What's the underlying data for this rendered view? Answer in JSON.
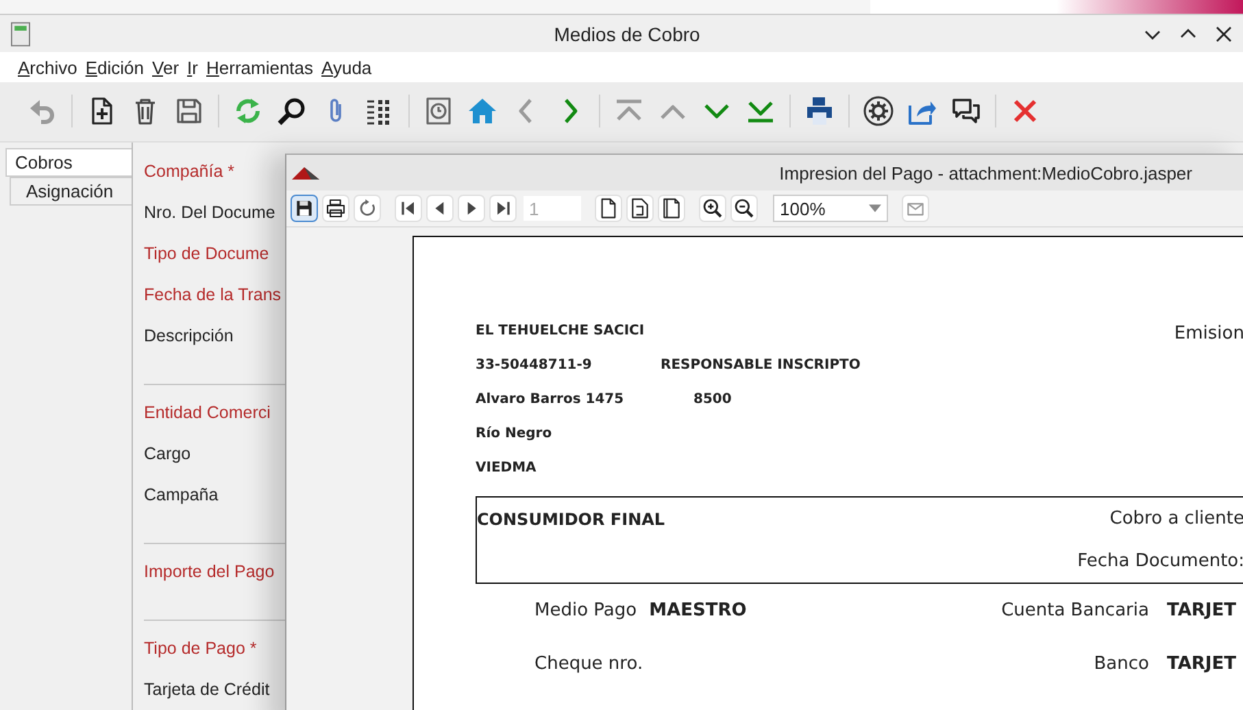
{
  "window": {
    "title": "Medios de Cobro"
  },
  "menu": [
    {
      "label": "Archivo"
    },
    {
      "label": "Edición"
    },
    {
      "label": "Ver"
    },
    {
      "label": "Ir"
    },
    {
      "label": "Herramientas"
    },
    {
      "label": "Ayuda"
    }
  ],
  "toolbar": [
    [
      {
        "kind": "undo",
        "disabled": true
      }
    ],
    [
      {
        "kind": "new",
        "disabled": false
      },
      {
        "kind": "delete",
        "disabled": false
      },
      {
        "kind": "save",
        "disabled": false
      }
    ],
    [
      {
        "kind": "refresh",
        "disabled": false
      },
      {
        "kind": "find",
        "disabled": false
      },
      {
        "kind": "attach",
        "disabled": false
      },
      {
        "kind": "grid",
        "disabled": false
      }
    ],
    [
      {
        "kind": "history",
        "disabled": false
      },
      {
        "kind": "home",
        "disabled": false
      },
      {
        "kind": "back",
        "disabled": true
      },
      {
        "kind": "forward",
        "disabled": false
      }
    ],
    [
      {
        "kind": "first",
        "disabled": true
      },
      {
        "kind": "prev",
        "disabled": true
      },
      {
        "kind": "next",
        "disabled": false
      },
      {
        "kind": "last",
        "disabled": false
      }
    ],
    [
      {
        "kind": "print",
        "disabled": false
      }
    ],
    [
      {
        "kind": "process",
        "disabled": false
      },
      {
        "kind": "export",
        "disabled": false
      },
      {
        "kind": "chat",
        "disabled": false
      }
    ],
    [
      {
        "kind": "close",
        "disabled": false
      }
    ]
  ],
  "tabs": [
    {
      "label": "Cobros",
      "selected": true
    },
    {
      "label": "Asignación",
      "selected": false
    }
  ],
  "form_groups": [
    [
      {
        "label": "Compañía *",
        "mandatory": true
      },
      {
        "label": "Nro. Del Docume",
        "mandatory": false
      },
      {
        "label": "Tipo de Docume",
        "mandatory": true
      },
      {
        "label": "Fecha de la Trans",
        "mandatory": true
      },
      {
        "label": "Descripción",
        "mandatory": false
      }
    ],
    [
      {
        "label": "Entidad Comerci",
        "mandatory": true
      },
      {
        "label": "Cargo",
        "mandatory": false
      },
      {
        "label": "Campaña",
        "mandatory": false
      }
    ],
    [
      {
        "label": "Importe del Pago",
        "mandatory": true
      }
    ],
    [
      {
        "label": "Tipo de Pago *",
        "mandatory": true
      },
      {
        "label": "Tarjeta de Crédit",
        "mandatory": false
      }
    ]
  ],
  "report_window": {
    "title": "Impresion del Pago - attachment:MedioCobro.jasper",
    "toolbar": [
      [
        {
          "kind": "save",
          "disabled": false
        },
        {
          "kind": "print",
          "disabled": false
        },
        {
          "kind": "reload",
          "disabled": false
        }
      ],
      [
        {
          "kind": "first",
          "disabled": false
        },
        {
          "kind": "prev",
          "disabled": false
        },
        {
          "kind": "next",
          "disabled": false
        },
        {
          "kind": "last",
          "disabled": false
        }
      ],
      [
        {
          "kind": "page-actual",
          "disabled": false
        },
        {
          "kind": "page-width",
          "disabled": false
        },
        {
          "kind": "page-fit",
          "disabled": false
        }
      ],
      [
        {
          "kind": "zoom-in",
          "disabled": false
        },
        {
          "kind": "zoom-out",
          "disabled": false
        }
      ],
      [
        {
          "kind": "email",
          "disabled": true
        }
      ]
    ],
    "page_number": "1",
    "zoom": "100%",
    "document": {
      "issuer_name": "EL TEHUELCHE SACICI",
      "emission_label": "Emision",
      "tax_id": "33-50448711-9",
      "tax_status": "RESPONSABLE INSCRIPTO",
      "address": "Alvaro Barros 1475",
      "postal_code": "8500",
      "province": "Río Negro",
      "city": "VIEDMA",
      "customer": "CONSUMIDOR FINAL",
      "doc_type": "Cobro a cliente",
      "date_label": "Fecha Documento:",
      "details": [
        {
          "left_label": "Medio Pago",
          "left_value": "MAESTRO",
          "right_label": "Cuenta Bancaria",
          "right_value": "TARJET"
        },
        {
          "left_label": "Cheque nro.",
          "right_label": "Banco",
          "right_value": "TARJET"
        }
      ]
    }
  }
}
